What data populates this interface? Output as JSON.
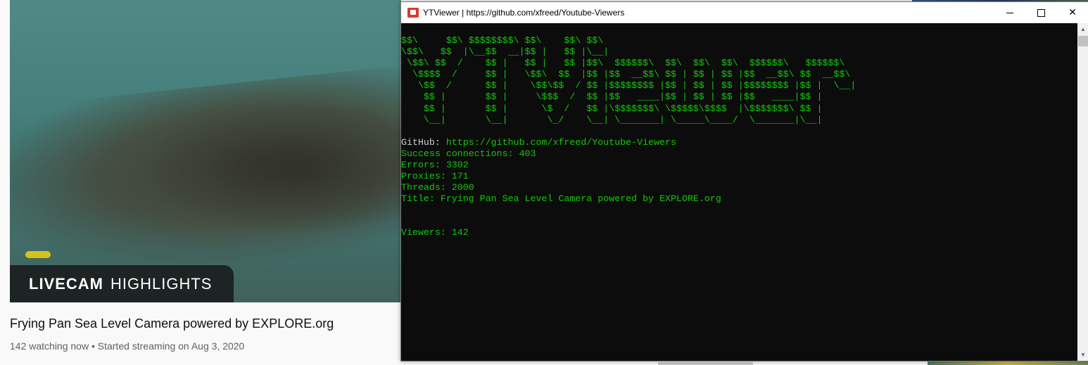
{
  "youtube": {
    "badge_bold": "LIVECAM",
    "badge_light": "HIGHLIGHTS",
    "video_title": "Frying Pan Sea Level Camera powered by EXPLORE.org",
    "video_meta": "142 watching now • Started streaming on Aug 3, 2020"
  },
  "console": {
    "window_title": "YTViewer | https://github.com/xfreed/Youtube-Viewers",
    "icons": {
      "app": "youtube-icon",
      "minimize": "minimize-icon",
      "maximize": "maximize-icon",
      "close": "close-icon"
    },
    "close_label": "✕",
    "ascii_art": "$$\\     $$\\ $$$$$$$$\\ $$\\    $$\\ $$\\\n\\$$\\   $$  |\\__$$  __|$$ |   $$ |\\__|\n \\$$\\ $$  /    $$ |   $$ |   $$ |$$\\  $$$$$$\\  $$\\  $$\\  $$\\  $$$$$$\\   $$$$$$\\\n  \\$$$$  /     $$ |   \\$$\\  $$  |$$ |$$  __$$\\ $$ | $$ | $$ |$$  __$$\\ $$  __$$\\\n   \\$$  /      $$ |    \\$$\\$$  / $$ |$$$$$$$$ |$$ | $$ | $$ |$$$$$$$$ |$$ |  \\__|\n    $$ |       $$ |     \\$$$  /  $$ |$$   ____|$$ | $$ | $$ |$$   ____|$$ |\n    $$ |       $$ |      \\$  /   $$ |\\$$$$$$$\\ \\$$$$$\\$$$$  |\\$$$$$$$\\ $$ |\n    \\__|       \\__|       \\_/    \\__| \\_______| \\_____\\____/  \\_______|\\__|",
    "github_label": "GitHub:",
    "github_url": "https://github.com/xfreed/Youtube-Viewers",
    "stats": {
      "success": "Success connections: 403",
      "errors": "Errors: 3302",
      "proxies": "Proxies: 171",
      "threads": "Threads: 2000",
      "title": "Title: Frying Pan Sea Level Camera powered by EXPLORE.org"
    },
    "viewers": "Viewers: 142",
    "text_color": "#16c60c",
    "background_color": "#0c0c0c"
  }
}
